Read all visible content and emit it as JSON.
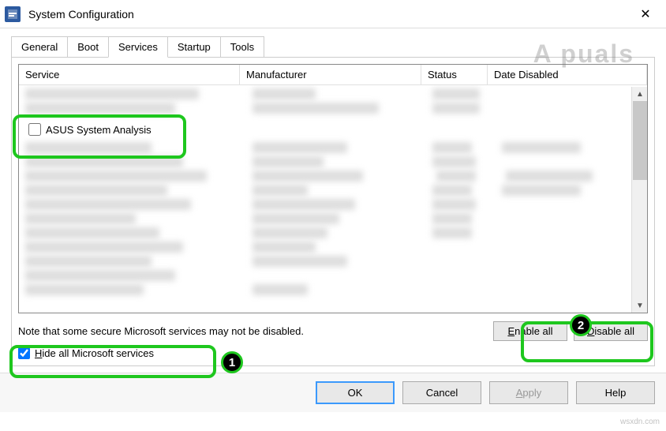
{
  "window": {
    "title": "System Configuration"
  },
  "tabs": {
    "general": "General",
    "boot": "Boot",
    "services": "Services",
    "startup": "Startup",
    "tools": "Tools"
  },
  "columns": {
    "service": "Service",
    "manufacturer": "Manufacturer",
    "status": "Status",
    "date_disabled": "Date Disabled"
  },
  "rows": {
    "asus": {
      "label": "ASUS System Analysis",
      "checked": false
    }
  },
  "note": "Note that some secure Microsoft services may not be disabled.",
  "buttons": {
    "enable_all": "Enable all",
    "disable_all": "Disable all",
    "ok": "OK",
    "cancel": "Cancel",
    "apply": "Apply",
    "help": "Help"
  },
  "checkbox": {
    "hide_label": "Hide all Microsoft services",
    "hide_checked": true
  },
  "badges": {
    "one": "1",
    "two": "2"
  },
  "watermarks": {
    "brand": "A  puals",
    "site": "wsxdn.com"
  }
}
